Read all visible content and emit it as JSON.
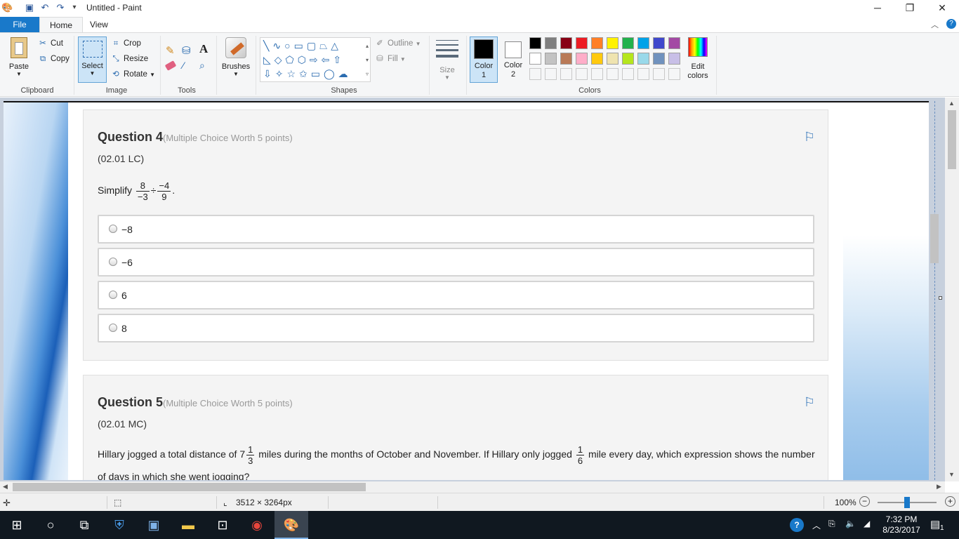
{
  "window": {
    "title": "Untitled - Paint",
    "controls": {
      "minimize": "─",
      "restore": "❐",
      "close": "✕"
    }
  },
  "ribbon_tabs": {
    "file": "File",
    "home": "Home",
    "view": "View"
  },
  "ribbon": {
    "clipboard": {
      "paste": "Paste",
      "cut": "Cut",
      "copy": "Copy",
      "group": "Clipboard"
    },
    "image": {
      "select": "Select",
      "crop": "Crop",
      "resize": "Resize",
      "rotate": "Rotate",
      "group": "Image"
    },
    "tools": {
      "group": "Tools"
    },
    "brushes": {
      "label": "Brushes"
    },
    "shapes": {
      "outline": "Outline",
      "fill": "Fill",
      "group": "Shapes"
    },
    "size": {
      "label": "Size"
    },
    "colors": {
      "color1": "Color\n1",
      "color1_a": "Color",
      "color1_b": "1",
      "color2_a": "Color",
      "color2_b": "2",
      "edit_a": "Edit",
      "edit_b": "colors",
      "group": "Colors",
      "row1": [
        "#000000",
        "#7f7f7f",
        "#880015",
        "#ed1c24",
        "#ff7f27",
        "#fff200",
        "#22b14c",
        "#00a2e8",
        "#3f48cc",
        "#a349a4"
      ],
      "row2": [
        "#ffffff",
        "#c3c3c3",
        "#b97a57",
        "#ffaec9",
        "#ffc90e",
        "#efe4b0",
        "#b5e61d",
        "#99d9ea",
        "#7092be",
        "#c8bfe7"
      ]
    }
  },
  "questions": [
    {
      "title": "Question 4",
      "worth": "(Multiple Choice Worth 5 points)",
      "code": "(02.01 LC)",
      "prompt_prefix": "Simplify",
      "frac1_num": "8",
      "frac1_den": "−3",
      "op": "÷",
      "frac2_num": "−4",
      "frac2_den": "9",
      "prompt_suffix": ".",
      "options": [
        "−8",
        "−6",
        "6",
        "8"
      ]
    },
    {
      "title": "Question 5",
      "worth": "(Multiple Choice Worth 5 points)",
      "code": "(02.01 MC)",
      "text_a": "Hillary jogged a total distance of 7",
      "mixed_num": "1",
      "mixed_den": "3",
      "text_b": "miles during the months of October and November. If Hillary only jogged",
      "frac_num": "1",
      "frac_den": "6",
      "text_c": "mile every day, which expression shows the number",
      "text_d": "of days in which she went jogging?"
    }
  ],
  "status": {
    "canvas_size": "3512 × 3264px",
    "zoom": "100%"
  },
  "taskbar": {
    "time": "7:32 PM",
    "date": "8/23/2017",
    "notifications": "1"
  }
}
